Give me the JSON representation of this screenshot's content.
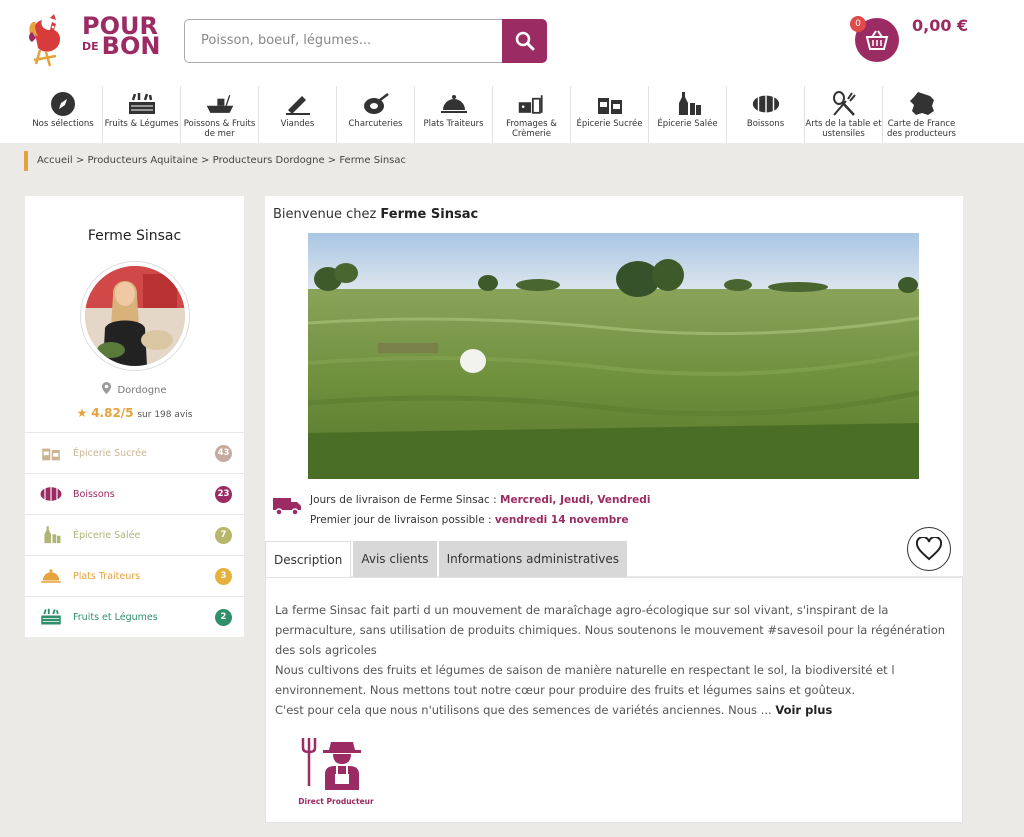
{
  "header": {
    "logo": {
      "line1": "POUR",
      "line2_small": "DE",
      "line2": "BON"
    },
    "search_placeholder": "Poisson, boeuf, légumes...",
    "cart_count": "0",
    "cart_total": "0,00 €"
  },
  "nav": [
    {
      "label": "Nos sélections",
      "icon": "compass-icon"
    },
    {
      "label": "Fruits & Légumes",
      "icon": "vegetable-crate-icon"
    },
    {
      "label": "Poissons & Fruits de mer",
      "icon": "boat-icon"
    },
    {
      "label": "Viandes",
      "icon": "cleaver-icon"
    },
    {
      "label": "Charcuteries",
      "icon": "ham-icon"
    },
    {
      "label": "Plats Traiteurs",
      "icon": "cloche-icon"
    },
    {
      "label": "Fromages & Crèmerie",
      "icon": "cheese-icon"
    },
    {
      "label": "Épicerie Sucrée",
      "icon": "jars-icon"
    },
    {
      "label": "Épicerie Salée",
      "icon": "bottles-icon"
    },
    {
      "label": "Boissons",
      "icon": "barrel-icon"
    },
    {
      "label": "Arts de la table et ustensiles",
      "icon": "utensils-icon"
    },
    {
      "label": "Carte de France des producteurs",
      "icon": "france-map-icon"
    }
  ],
  "breadcrumb": "Accueil > Producteurs Aquitaine > Producteurs Dordogne > Ferme Sinsac",
  "producer": {
    "name": "Ferme Sinsac",
    "location": "Dordogne",
    "rating": "4.82/5",
    "rating_count": "sur 198 avis",
    "categories": [
      {
        "label": "Épicerie Sucrée",
        "count": "43",
        "color": "#c9b48f",
        "badge": "#c6a9a0",
        "icon": "jars-icon"
      },
      {
        "label": "Boissons",
        "count": "23",
        "color": "#9b2b63",
        "badge": "#9b2b63",
        "icon": "barrel-icon"
      },
      {
        "label": "Épicerie Salée",
        "count": "7",
        "color": "#b0b576",
        "badge": "#b7b66a",
        "icon": "bottles-icon"
      },
      {
        "label": "Plats Traiteurs",
        "count": "3",
        "color": "#e6a23c",
        "badge": "#e6b03c",
        "icon": "cloche-icon"
      },
      {
        "label": "Fruits et Légumes",
        "count": "2",
        "color": "#2f8f6a",
        "badge": "#2f8f6a",
        "icon": "vegetable-crate-icon"
      }
    ]
  },
  "main": {
    "welcome_prefix": "Bienvenue chez",
    "welcome_name": "Ferme Sinsac",
    "delivery_days_label": "Jours de livraison de Ferme Sinsac :",
    "delivery_days": "Mercredi, Jeudi, Vendredi",
    "first_delivery_label": "Premier jour de livraison possible :",
    "first_delivery": "vendredi 14 novembre"
  },
  "tabs": [
    "Description",
    "Avis clients",
    "Informations administratives"
  ],
  "description": {
    "text": "La ferme Sinsac fait parti d un mouvement de maraîchage agro-écologique sur sol vivant, s'inspirant de la permaculture, sans utilisation de produits chimiques. Nous soutenons le mouvement #savesoil pour la régénération des sols agricoles\nNous cultivons des fruits et légumes de saison de manière naturelle en respectant le sol, la biodiversité et l environnement. Nous mettons tout notre cœur pour produire des fruits et légumes sains et goûteux.\nC'est pour cela que nous n'utilisons que des semences de variétés anciennes. Nous ...",
    "more": "Voir plus",
    "badge": "Direct Producteur"
  },
  "colors": {
    "brand": "#9b2b63",
    "accent": "#e6a23c",
    "background": "#ebeae6"
  }
}
